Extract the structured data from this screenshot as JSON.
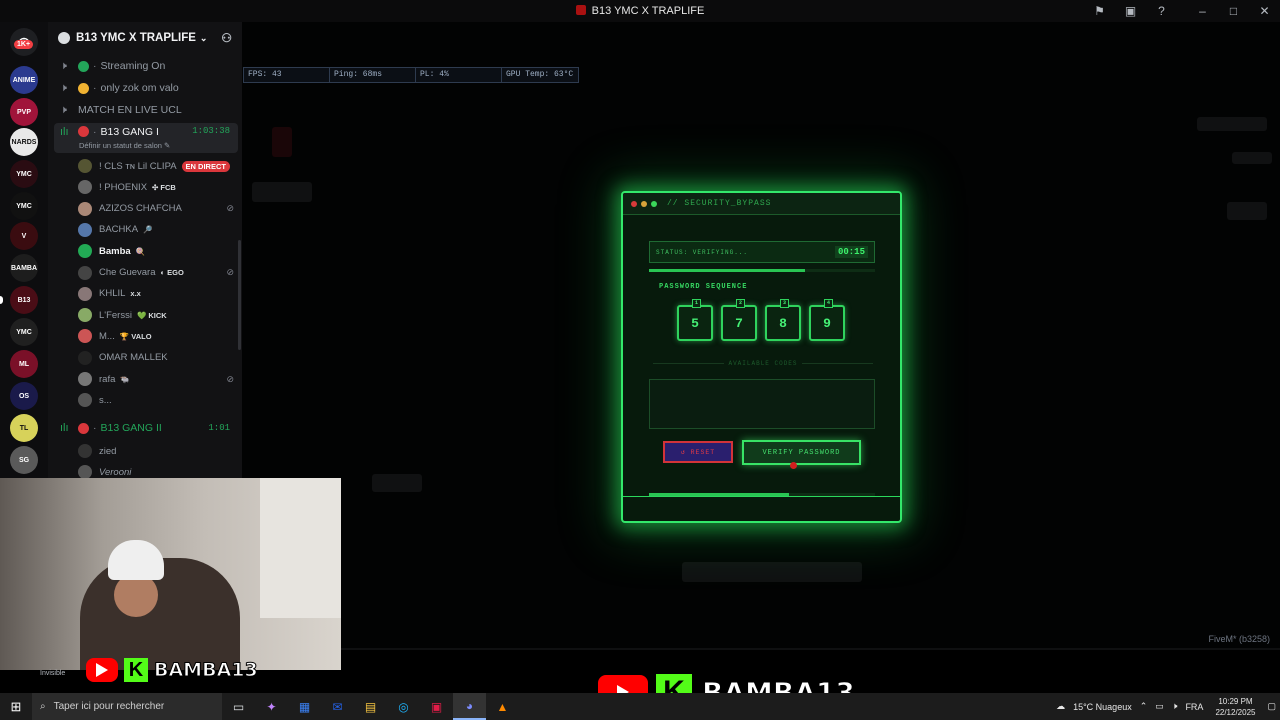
{
  "window": {
    "title": "B13 YMC X TRAPLIFE"
  },
  "server_rail": {
    "home_badge": "1K+",
    "servers": [
      {
        "label": "ANIME",
        "color": "#2b3a8f"
      },
      {
        "label": "PVP",
        "color": "#a0143a"
      },
      {
        "label": "NARDS",
        "color": "#e9e9e9"
      },
      {
        "label": "YMC",
        "color": "#2a0c12"
      },
      {
        "label": "YMC",
        "color": "#111111"
      },
      {
        "label": "V",
        "color": "#3a0c10"
      },
      {
        "label": "BAMBA",
        "color": "#1d1d1d"
      },
      {
        "label": "B13",
        "color": "#4a0d16"
      },
      {
        "label": "YMC",
        "color": "#202020"
      },
      {
        "label": "ML",
        "color": "#7a1028"
      },
      {
        "label": "OS",
        "color": "#1a1a4a"
      },
      {
        "label": "TL",
        "color": "#d7d25a"
      },
      {
        "label": "SG",
        "color": "#5a5a5a"
      }
    ]
  },
  "sidebar": {
    "server_name": "B13 YMC X TRAPLIFE",
    "channels": [
      {
        "name": "Streaming On",
        "dot": "#23a55a"
      },
      {
        "name": "only zok om valo",
        "dot": "#f0b232"
      },
      {
        "name": "MATCH EN LIVE UCL",
        "dot": ""
      }
    ],
    "active_channel": {
      "name": "B13 GANG I",
      "timer": "1:03:38",
      "status_hint": "Définir un statut de salon"
    },
    "members": [
      {
        "name": "! CLS ᴛɴ Lil CLIPA",
        "extra": "EN DIRECT"
      },
      {
        "name": "! PHOENIX",
        "extra": "✣ FCB"
      },
      {
        "name": "AZIZOS CHAFCHA",
        "extra": ""
      },
      {
        "name": "BACHKA",
        "extra": "🔎"
      },
      {
        "name": "Bamba",
        "extra": "🍭"
      },
      {
        "name": "Che Guevara",
        "extra": "◐ EGO"
      },
      {
        "name": "KHLIL",
        "extra": "x.x"
      },
      {
        "name": "L'Ferssi",
        "extra": "💚 KICK"
      },
      {
        "name": "M...",
        "extra": "🏆 VALO"
      },
      {
        "name": "OMAR MALLEK",
        "extra": ""
      },
      {
        "name": "rafa",
        "extra": "🐃"
      },
      {
        "name": "s...",
        "extra": ""
      }
    ],
    "second_channel": {
      "name": "B13 GANG II",
      "timer": "1:01"
    },
    "second_members": [
      {
        "name": "zied"
      },
      {
        "name": "Verooni"
      }
    ]
  },
  "perf_bar": {
    "fps": "FPS: 43",
    "ping": "Ping: 68ms",
    "pl": "PL: 4%",
    "gpu": "GPU Temp: 63°C"
  },
  "terminal": {
    "title": "// SECURITY_BYPASS",
    "status": "STATUS: VERIFYING...",
    "timer": "00:15",
    "top_progress": 0.69,
    "sequence_label": "PASSWORD SEQUENCE",
    "digits": [
      {
        "index": "1",
        "value": "5"
      },
      {
        "index": "2",
        "value": "7"
      },
      {
        "index": "3",
        "value": "8"
      },
      {
        "index": "4",
        "value": "9"
      }
    ],
    "available_label": "AVAILABLE CODES",
    "reset_label": "↺ RESET",
    "verify_label": "VERIFY PASSWORD",
    "bottom_progress": 0.62,
    "accent": "#33e86b"
  },
  "game": {
    "watermark": "FiveM* (b3258)"
  },
  "webcam": {
    "user_status": "Invisible"
  },
  "brand": {
    "name": "BAMBA13",
    "kick_letter": "K"
  },
  "taskbar": {
    "search_placeholder": "Taper ici pour rechercher",
    "weather": "15°C Nuageux",
    "lang": "FRA",
    "time": "10:29 PM",
    "date": "22/12/2025"
  }
}
